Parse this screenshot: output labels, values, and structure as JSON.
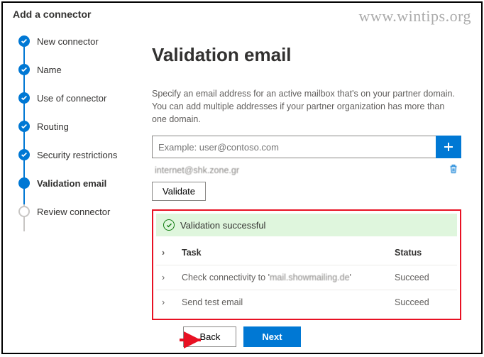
{
  "header": {
    "title": "Add a connector"
  },
  "watermark": "www.wintips.org",
  "steps": [
    {
      "label": "New connector",
      "state": "done"
    },
    {
      "label": "Name",
      "state": "done"
    },
    {
      "label": "Use of connector",
      "state": "done"
    },
    {
      "label": "Routing",
      "state": "done"
    },
    {
      "label": "Security restrictions",
      "state": "done"
    },
    {
      "label": "Validation email",
      "state": "current"
    },
    {
      "label": "Review connector",
      "state": "pending"
    }
  ],
  "main": {
    "title": "Validation email",
    "description": "Specify an email address for an active mailbox that's on your partner domain. You can add multiple addresses if your partner organization has more than one domain.",
    "input_placeholder": "Example: user@contoso.com",
    "added_email": "internet@shk.zone.gr",
    "validate_label": "Validate",
    "success_text": "Validation successful",
    "table": {
      "task_header": "Task",
      "status_header": "Status",
      "rows": [
        {
          "task": "Check connectivity to 'mail.showmailing.de'",
          "status": "Succeed"
        },
        {
          "task": "Send test email",
          "status": "Succeed"
        }
      ]
    }
  },
  "footer": {
    "back": "Back",
    "next": "Next"
  }
}
